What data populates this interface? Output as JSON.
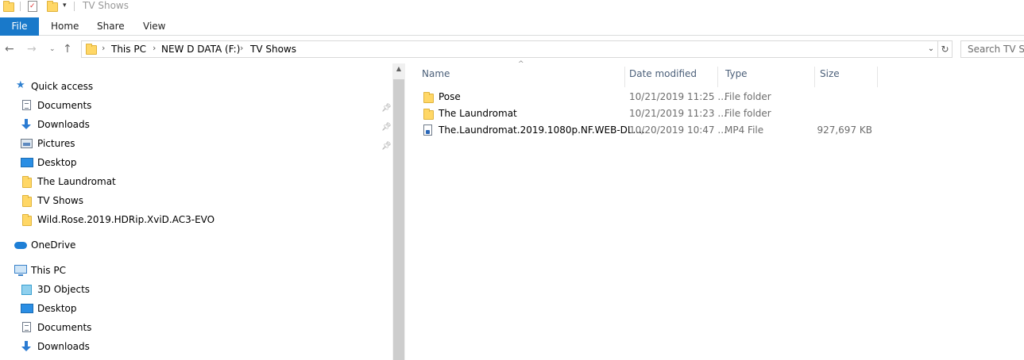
{
  "window": {
    "title": "TV Shows"
  },
  "quick_access_toolbar": {
    "icons": [
      "folder-icon",
      "properties-icon",
      "new-folder-icon",
      "customize-dropdown-icon"
    ]
  },
  "ribbon": {
    "file_label": "File",
    "tabs": [
      "Home",
      "Share",
      "View"
    ]
  },
  "address": {
    "crumbs": [
      "This PC",
      "NEW D DATA (F:)",
      "TV Shows"
    ],
    "search_placeholder": "Search TV Shows"
  },
  "nav": {
    "quick_access_label": "Quick access",
    "quick_items": [
      {
        "label": "Documents",
        "icon": "documents-icon",
        "pinned": true
      },
      {
        "label": "Downloads",
        "icon": "downloads-icon",
        "pinned": true
      },
      {
        "label": "Pictures",
        "icon": "pictures-icon",
        "pinned": true
      },
      {
        "label": "Desktop",
        "icon": "desktop-icon",
        "pinned": false
      },
      {
        "label": "The Laundromat",
        "icon": "folder-icon",
        "pinned": false
      },
      {
        "label": "TV Shows",
        "icon": "folder-icon",
        "pinned": false
      },
      {
        "label": "Wild.Rose.2019.HDRip.XviD.AC3-EVO",
        "icon": "folder-icon",
        "pinned": false
      }
    ],
    "onedrive_label": "OneDrive",
    "this_pc_label": "This PC",
    "pc_items": [
      {
        "label": "3D Objects",
        "icon": "3d-objects-icon"
      },
      {
        "label": "Desktop",
        "icon": "desktop-icon"
      },
      {
        "label": "Documents",
        "icon": "documents-icon"
      },
      {
        "label": "Downloads",
        "icon": "downloads-icon"
      }
    ]
  },
  "columns": {
    "name": "Name",
    "date": "Date modified",
    "type": "Type",
    "size": "Size"
  },
  "files": [
    {
      "name": "Pose",
      "date": "10/21/2019 11:25 ...",
      "type": "File folder",
      "size": "",
      "icon": "folder-icon"
    },
    {
      "name": "The Laundromat",
      "date": "10/21/2019 11:23 ...",
      "type": "File folder",
      "size": "",
      "icon": "folder-icon"
    },
    {
      "name": "The.Laundromat.2019.1080p.NF.WEB-DL....",
      "date": "10/20/2019 10:47 ...",
      "type": "MP4 File",
      "size": "927,697 KB",
      "icon": "video-file-icon"
    }
  ]
}
